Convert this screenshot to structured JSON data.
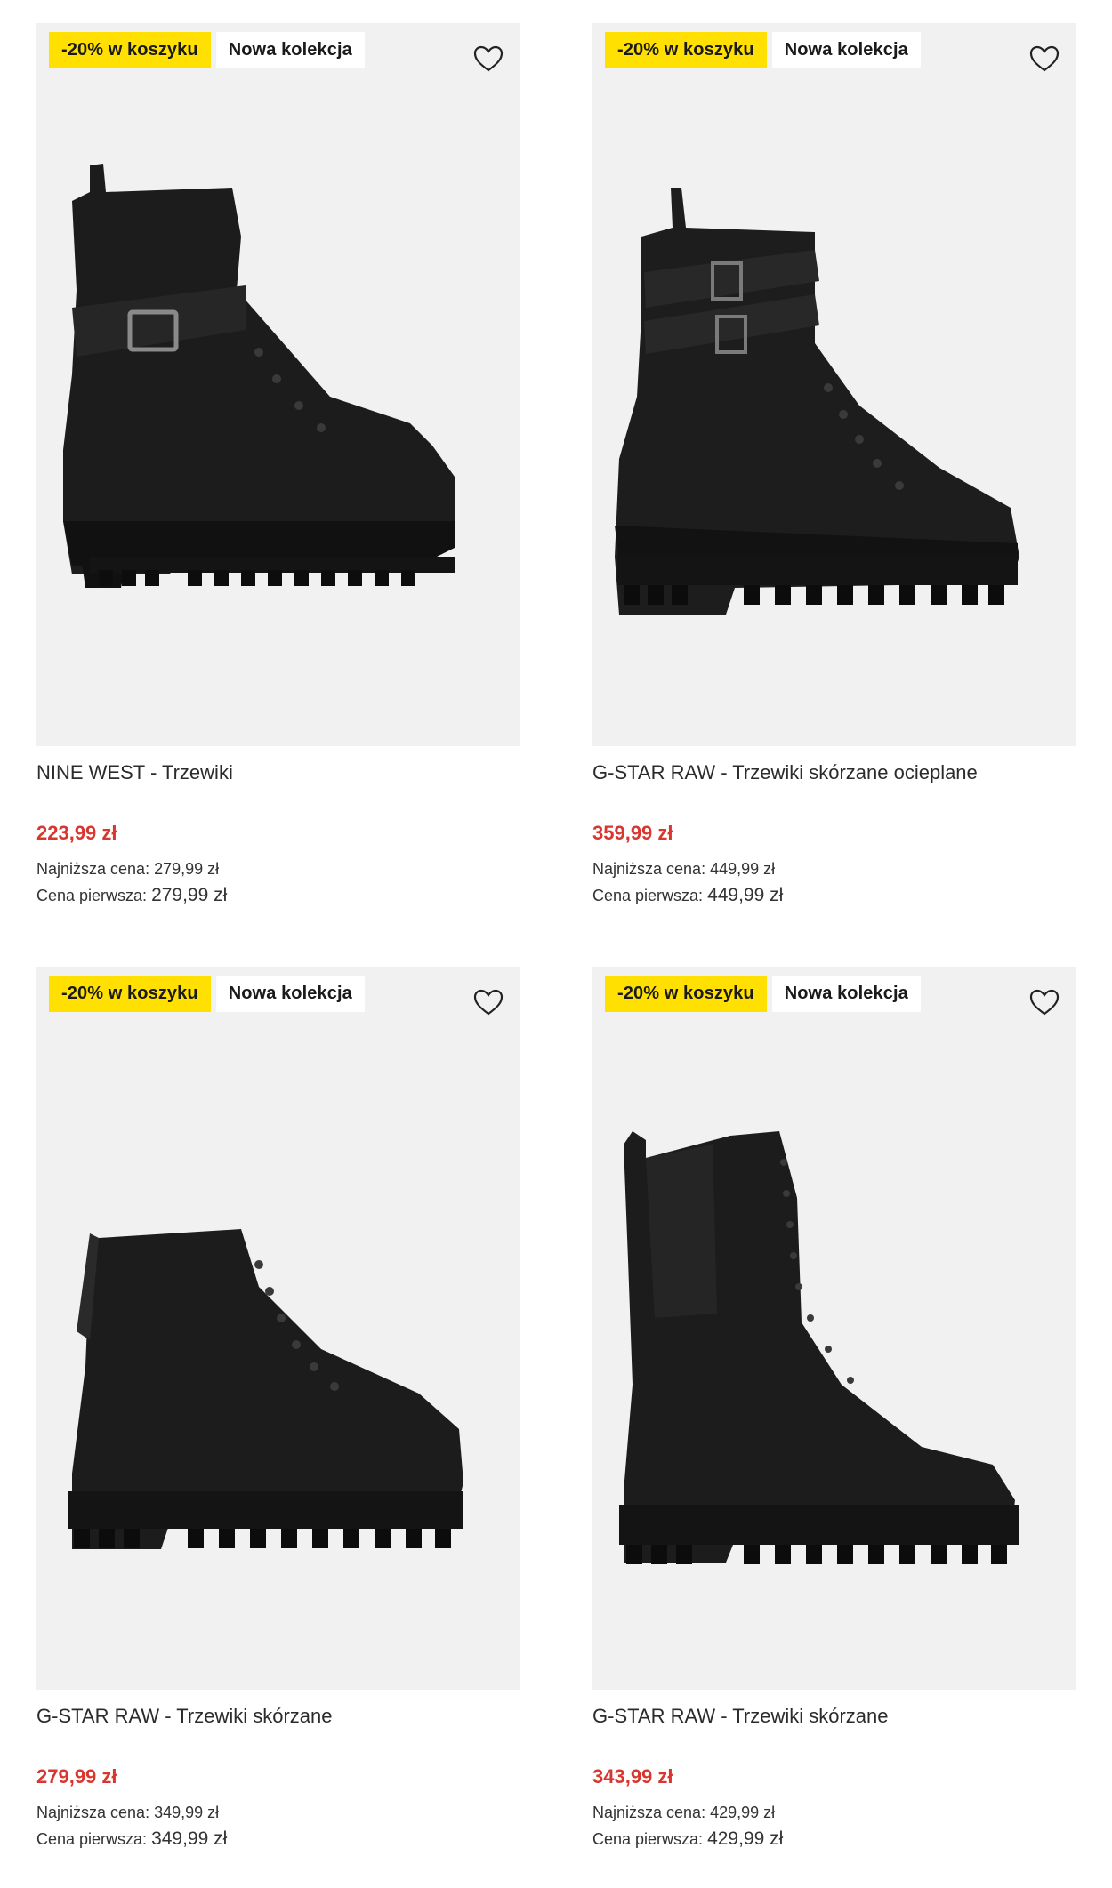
{
  "products": [
    {
      "badge_discount": "-20% w koszyku",
      "badge_new": "Nowa kolekcja",
      "title": "NINE WEST - Trzewiki",
      "price": "223,99 zł",
      "lowest_label": "Najniższa cena:",
      "lowest_value": "279,99 zł",
      "first_label": "Cena pierwsza:",
      "first_value": "279,99 zł"
    },
    {
      "badge_discount": "-20% w koszyku",
      "badge_new": "Nowa kolekcja",
      "title": "G-STAR RAW - Trzewiki skórzane ocieplane",
      "price": "359,99 zł",
      "lowest_label": "Najniższa cena:",
      "lowest_value": "449,99 zł",
      "first_label": "Cena pierwsza:",
      "first_value": "449,99 zł"
    },
    {
      "badge_discount": "-20% w koszyku",
      "badge_new": "Nowa kolekcja",
      "title": "G-STAR RAW - Trzewiki skórzane",
      "price": "279,99 zł",
      "lowest_label": "Najniższa cena:",
      "lowest_value": "349,99 zł",
      "first_label": "Cena pierwsza:",
      "first_value": "349,99 zł"
    },
    {
      "badge_discount": "-20% w koszyku",
      "badge_new": "Nowa kolekcja",
      "title": "G-STAR RAW - Trzewiki skórzane",
      "price": "343,99 zł",
      "lowest_label": "Najniższa cena:",
      "lowest_value": "429,99 zł",
      "first_label": "Cena pierwsza:",
      "first_value": "429,99 zł"
    }
  ],
  "icons": {
    "wishlist": "heart-outline-icon"
  },
  "colors": {
    "badge_discount_bg": "#ffe000",
    "price_sale": "#d8362f",
    "image_bg": "#f1f1f1",
    "boot": "#1c1c1c"
  }
}
